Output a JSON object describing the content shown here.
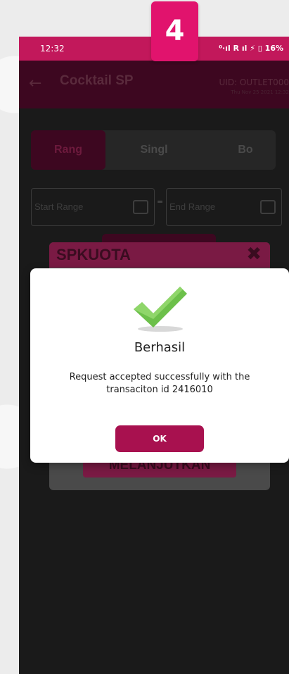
{
  "badge": "4",
  "statusbar": {
    "time": "12:32",
    "icons": "⁰·ıl R ıl ⚡ ▯ 16%"
  },
  "appbar": {
    "title": "Cocktail SP",
    "uid": "UID: OUTLET000",
    "date": "Thu Nov 25 2021 12:32"
  },
  "tabs": [
    {
      "label": "Rang"
    },
    {
      "label": "Singl"
    },
    {
      "label": "Bo"
    }
  ],
  "range": {
    "start_label": "Start Range",
    "separator": "-",
    "end_label": "End Range"
  },
  "quota_dialog": {
    "title": "SPKUOTA",
    "close": "✖",
    "continue_button": "MELANJUTKAN"
  },
  "success_modal": {
    "title": "Berhasil",
    "message": "Request accepted successfully with the transaciton id 2416010",
    "ok_button": "OK"
  },
  "colors": {
    "accent": "#e1136d",
    "primary": "#a8114f",
    "status_bar": "#c2185b",
    "check_green": "#6cc04a"
  }
}
